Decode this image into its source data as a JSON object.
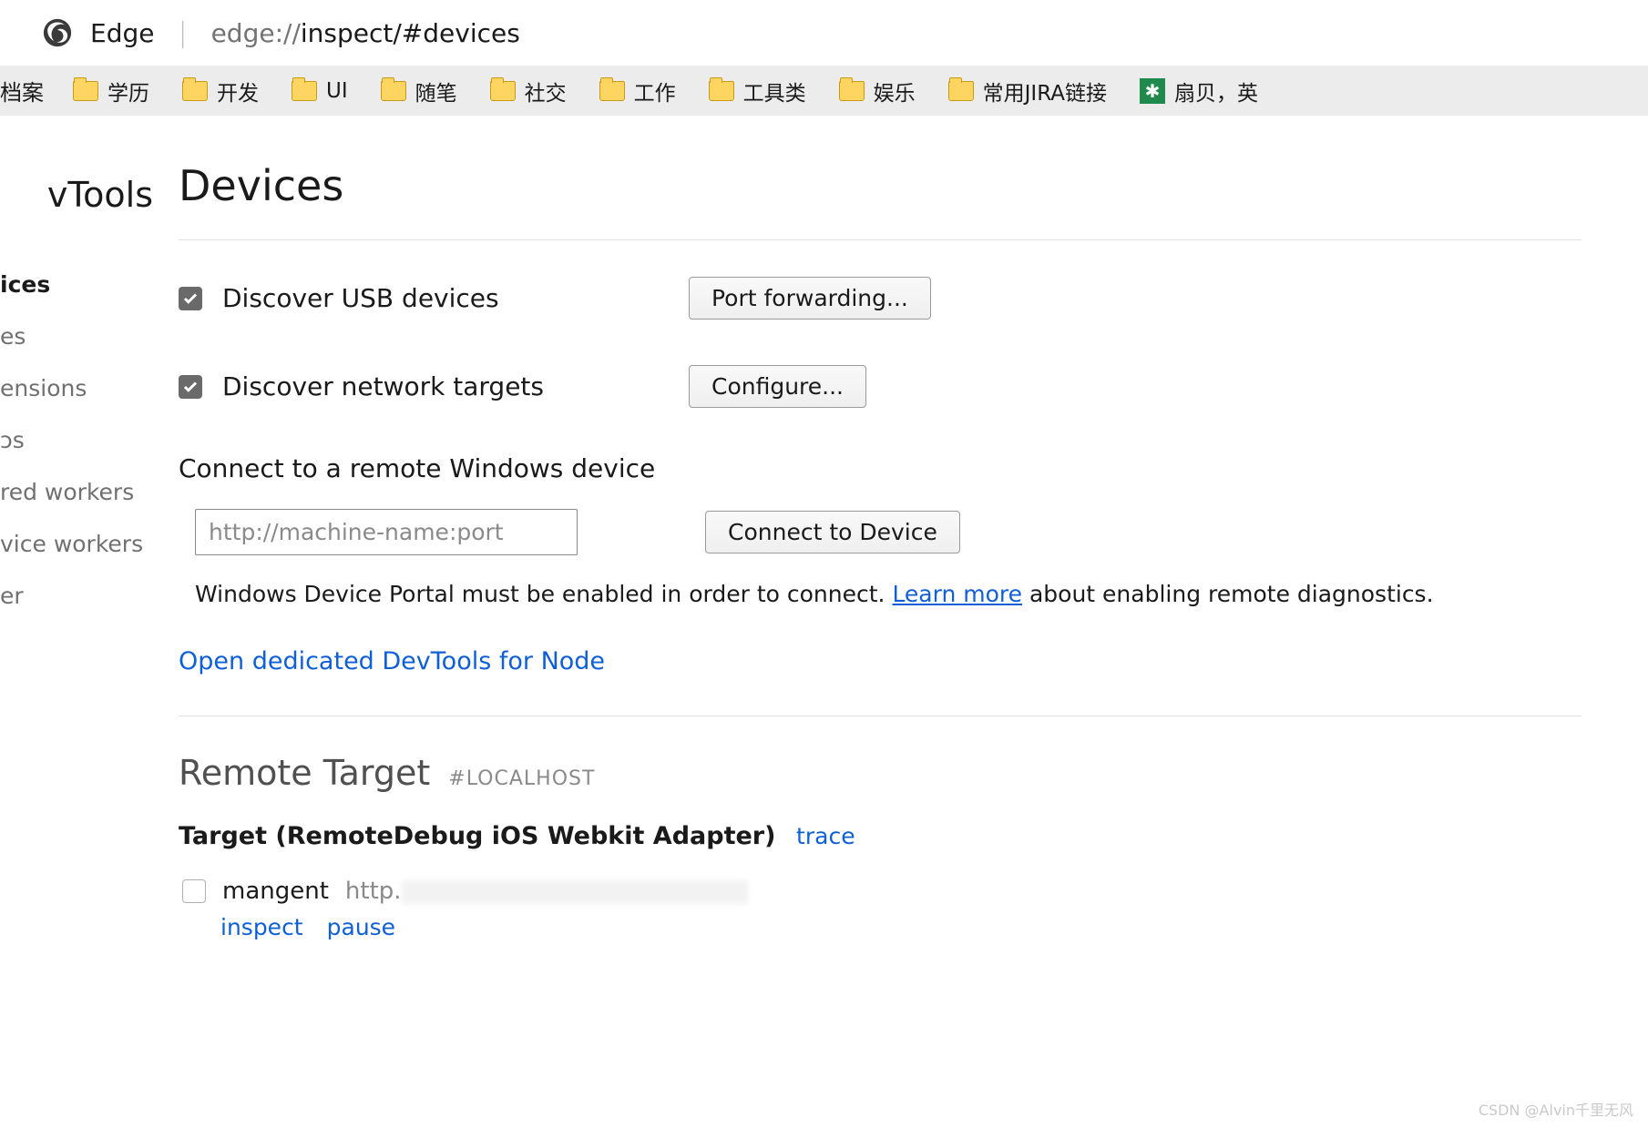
{
  "address": {
    "app_name": "Edge",
    "url_host": "edge://",
    "url_path": "inspect/#devices"
  },
  "bookmarks": {
    "trunc_left": "档案",
    "items": [
      {
        "label": "学历",
        "type": "folder"
      },
      {
        "label": "开发",
        "type": "folder"
      },
      {
        "label": "UI",
        "type": "folder"
      },
      {
        "label": "随笔",
        "type": "folder"
      },
      {
        "label": "社交",
        "type": "folder"
      },
      {
        "label": "工作",
        "type": "folder"
      },
      {
        "label": "工具类",
        "type": "folder"
      },
      {
        "label": "娱乐",
        "type": "folder"
      },
      {
        "label": "常用JIRA链接",
        "type": "folder"
      },
      {
        "label": "扇贝，英",
        "type": "app"
      }
    ]
  },
  "sidebar": {
    "title": "vTools",
    "items": [
      {
        "label": "ices",
        "active": true
      },
      {
        "label": "es",
        "active": false
      },
      {
        "label": "ensions",
        "active": false
      },
      {
        "label": "ᴐs",
        "active": false
      },
      {
        "label": "red workers",
        "active": false
      },
      {
        "label": "vice workers",
        "active": false
      },
      {
        "label": "er",
        "active": false
      }
    ]
  },
  "main": {
    "heading": "Devices",
    "discover_usb": "Discover USB devices",
    "port_forwarding_btn": "Port forwarding...",
    "discover_network": "Discover network targets",
    "configure_btn": "Configure...",
    "remote_windows_label": "Connect to a remote Windows device",
    "remote_placeholder": "http://machine-name:port",
    "connect_btn": "Connect to Device",
    "hint_pre": "Windows Device Portal must be enabled in order to connect. ",
    "hint_link": "Learn more",
    "hint_post": " about enabling remote diagnostics.",
    "open_node": "Open dedicated DevTools for Node",
    "remote_target_heading": "Remote Target",
    "remote_target_tag": "#LOCALHOST",
    "target_label_pre": "Target ",
    "target_label_paren": "(RemoteDebug iOS Webkit Adapter)",
    "trace": "trace",
    "entry_name": "mangent",
    "entry_url_prefix": "http.",
    "inspect": "inspect",
    "pause": "pause"
  },
  "watermark": "CSDN @Alvin千里无风"
}
